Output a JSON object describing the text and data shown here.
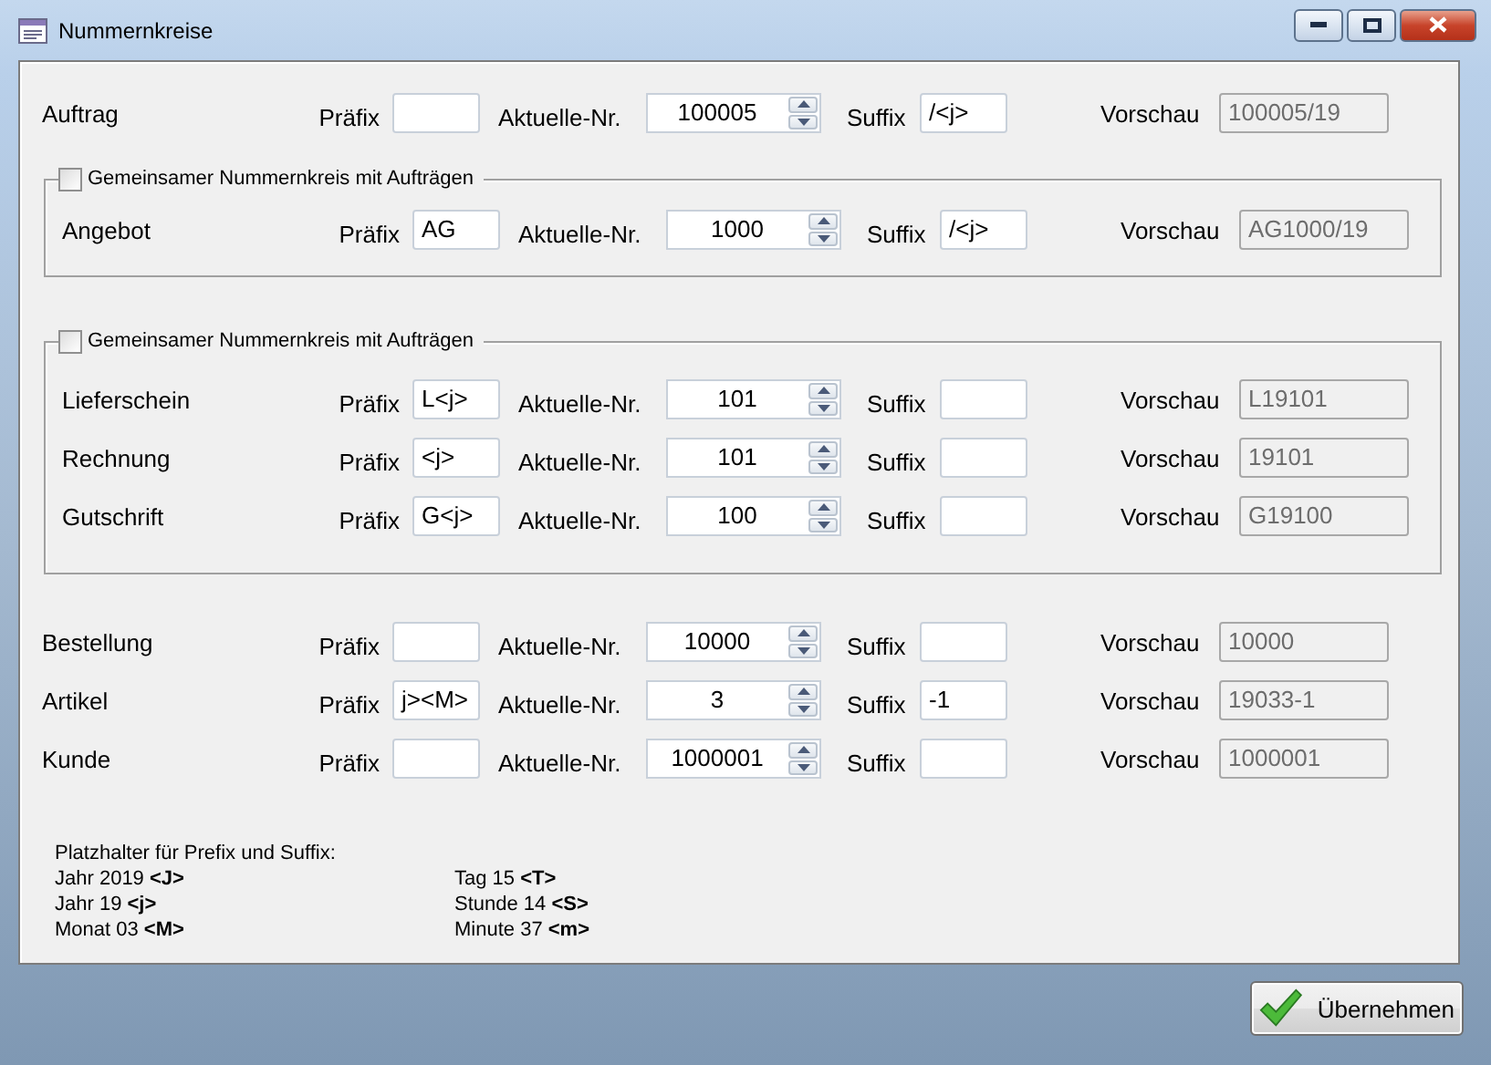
{
  "window": {
    "title": "Nummernkreise"
  },
  "sections": [
    {
      "kind": "plain",
      "rows": [
        {
          "name": "Auftrag",
          "prefix_label": "Präfix",
          "number_label": "Aktuelle-Nr.",
          "number": "100005",
          "suffix_label": "Suffix",
          "suffix": "/<j>",
          "preview_label": "Vorschau",
          "preview": "100005/19"
        }
      ]
    },
    {
      "kind": "group",
      "checkbox": {
        "label": "Gemeinsamer Nummernkreis mit Aufträgen",
        "checked": false
      },
      "rows": [
        {
          "name": "Angebot",
          "prefix_label": "Präfix",
          "prefix": "AG",
          "number_label": "Aktuelle-Nr.",
          "number": "1000",
          "suffix_label": "Suffix",
          "suffix": "/<j>",
          "preview_label": "Vorschau",
          "preview": "AG1000/19"
        }
      ]
    },
    {
      "kind": "group",
      "checkbox": {
        "label": "Gemeinsamer Nummernkreis mit Aufträgen",
        "checked": false
      },
      "rows": [
        {
          "name": "Lieferschein",
          "prefix_label": "Präfix",
          "prefix": "L<j>",
          "number_label": "Aktuelle-Nr.",
          "number": "101",
          "suffix_label": "Suffix",
          "preview_label": "Vorschau",
          "preview": "L19101"
        },
        {
          "name": "Rechnung",
          "prefix_label": "Präfix",
          "prefix": "<j>",
          "number_label": "Aktuelle-Nr.",
          "number": "101",
          "suffix_label": "Suffix",
          "preview_label": "Vorschau",
          "preview": "19101"
        },
        {
          "name": "Gutschrift",
          "prefix_label": "Präfix",
          "prefix": "G<j>",
          "number_label": "Aktuelle-Nr.",
          "number": "100",
          "suffix_label": "Suffix",
          "preview_label": "Vorschau",
          "preview": "G19100"
        }
      ]
    },
    {
      "kind": "plain",
      "rows": [
        {
          "name": "Bestellung",
          "prefix_label": "Präfix",
          "number_label": "Aktuelle-Nr.",
          "number": "10000",
          "suffix_label": "Suffix",
          "preview_label": "Vorschau",
          "preview": "10000"
        },
        {
          "name": "Artikel",
          "prefix_label": "Präfix",
          "prefix": "j><M>",
          "number_label": "Aktuelle-Nr.",
          "number": "3",
          "suffix_label": "Suffix",
          "suffix": "-1",
          "preview_label": "Vorschau",
          "preview": "19033-1"
        },
        {
          "name": "Kunde",
          "prefix_label": "Präfix",
          "number_label": "Aktuelle-Nr.",
          "number": "1000001",
          "suffix_label": "Suffix",
          "preview_label": "Vorschau",
          "preview": "1000001"
        }
      ]
    }
  ],
  "placeholders": {
    "title": "Platzhalter für Prefix und Suffix:",
    "columns": [
      [
        "Jahr 2019 **<J>**",
        "Jahr 19 **<j>**",
        "Monat 03 **<M>**"
      ],
      [
        "Tag 15 **<T>**",
        "Stunde 14 **<S>**",
        "Minute 37 **<m>**"
      ]
    ]
  },
  "apply_button": "Übernehmen"
}
